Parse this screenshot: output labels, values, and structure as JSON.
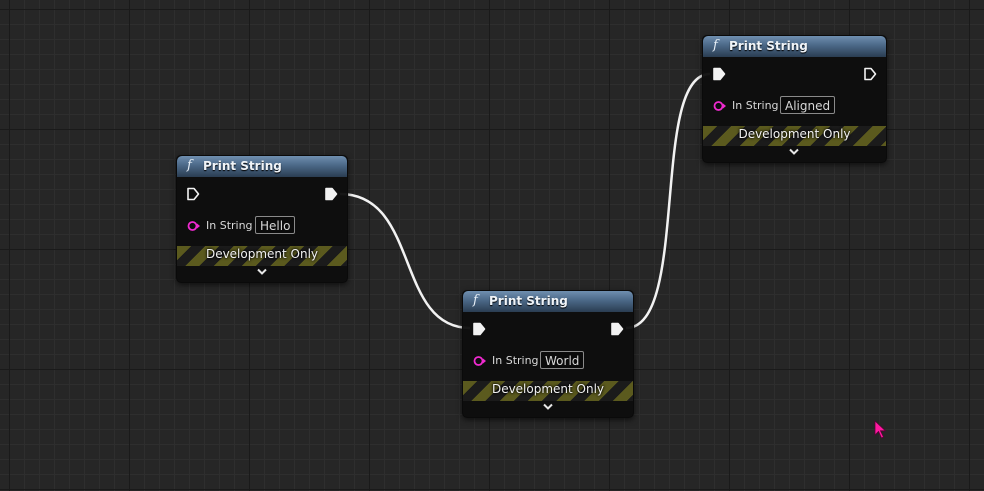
{
  "graph": {
    "nodes": [
      {
        "title": "Print String",
        "pin_label": "In String",
        "value": "Hello",
        "dev_label": "Development Only"
      },
      {
        "title": "Print String",
        "pin_label": "In String",
        "value": "World",
        "dev_label": "Development Only"
      },
      {
        "title": "Print String",
        "pin_label": "In String",
        "value": "Aligned",
        "dev_label": "Development Only"
      }
    ],
    "function_glyph": "f"
  },
  "colors": {
    "background": "#262626",
    "header": "#4b6887",
    "string_pin": "#f02ad0",
    "cursor": "#ff1aa0",
    "wire": "#ffffff",
    "hazard_stripe": "#5b5a1e"
  },
  "icons": {
    "exec_pin": "exec-arrow-icon",
    "data_pin": "string-pin-icon",
    "expand": "chevron-down-icon",
    "cursor": "mouse-cursor-icon"
  }
}
